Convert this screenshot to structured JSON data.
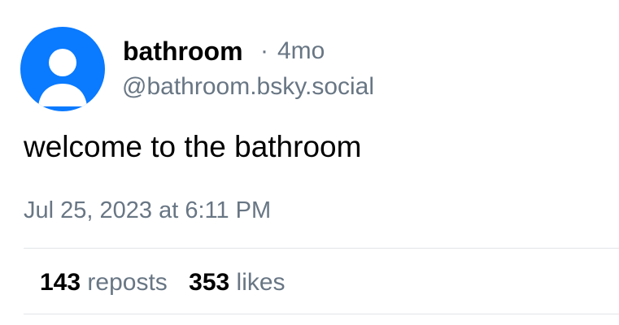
{
  "post": {
    "author": {
      "display_name": "bathroom",
      "handle": "@bathroom.bsky.social"
    },
    "separator": "·",
    "time_ago": "4mo",
    "text": "welcome to the bathroom",
    "timestamp": "Jul 25, 2023 at 6:11 PM",
    "stats": {
      "reposts_count": "143",
      "reposts_label": "reposts",
      "likes_count": "353",
      "likes_label": "likes"
    }
  },
  "avatar": {
    "icon": "default-user-icon",
    "background_color": "#0a7aff"
  },
  "colors": {
    "muted_text": "#687684",
    "primary_text": "#000000",
    "divider": "#e1e4e8"
  }
}
